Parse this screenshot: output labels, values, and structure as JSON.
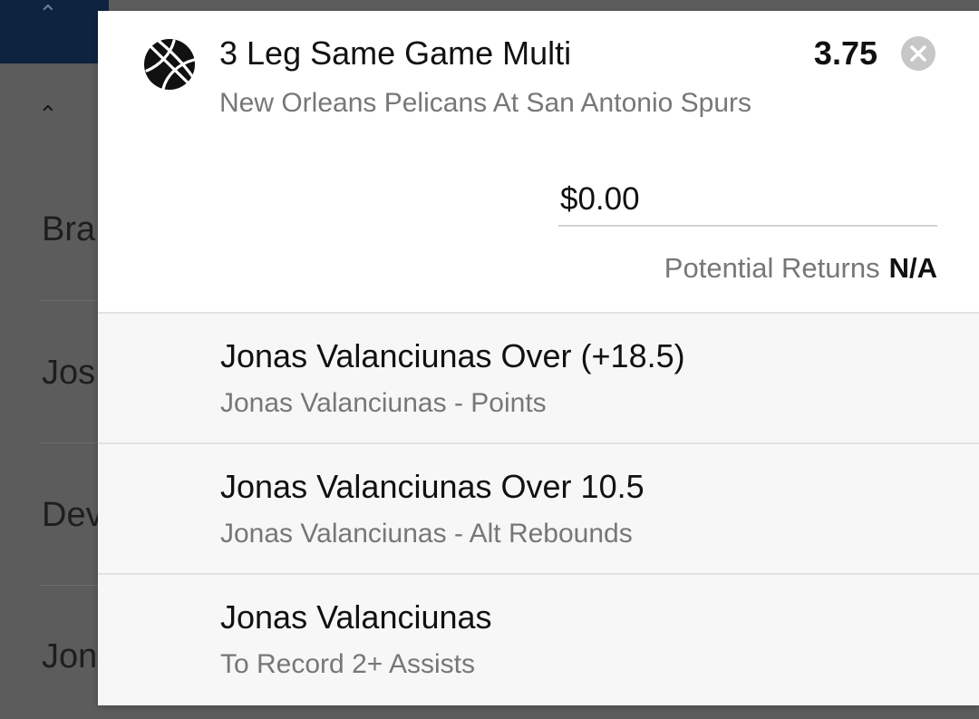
{
  "background": {
    "rows": [
      "Bra",
      "Jos",
      "Dev",
      "Jon"
    ]
  },
  "bet_slip": {
    "icon": "basketball-icon",
    "title": "3 Leg Same Game Multi",
    "odds": "3.75",
    "close_icon": "close-icon",
    "event": "New Orleans Pelicans At San Antonio Spurs",
    "stake": {
      "value": "",
      "placeholder": "$0.00"
    },
    "potential_returns": {
      "label": "Potential Returns",
      "value": "N/A"
    },
    "legs": [
      {
        "title": "Jonas Valanciunas Over (+18.5)",
        "market": "Jonas Valanciunas - Points"
      },
      {
        "title": "Jonas Valanciunas Over 10.5",
        "market": "Jonas Valanciunas - Alt Rebounds"
      },
      {
        "title": "Jonas Valanciunas",
        "market": "To Record 2+ Assists"
      }
    ]
  }
}
